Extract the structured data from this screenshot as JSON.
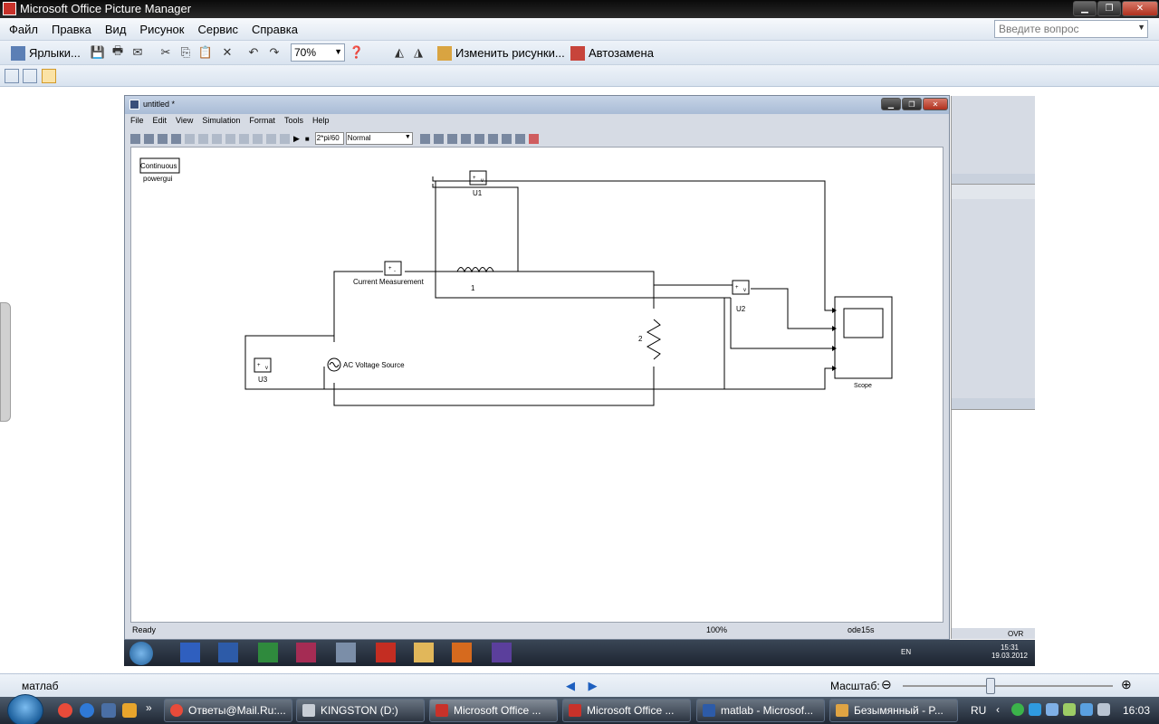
{
  "app": {
    "title": "Microsoft Office Picture Manager"
  },
  "menu": [
    "Файл",
    "Правка",
    "Вид",
    "Рисунок",
    "Сервис",
    "Справка"
  ],
  "help_search": {
    "placeholder": "Введите вопрос"
  },
  "toolbar": {
    "shortcuts_label": "Ярлыки...",
    "zoom_value": "70%",
    "edit_pictures_label": "Изменить рисунки...",
    "autocorrect_label": "Автозамена"
  },
  "simulink": {
    "title": "untitled *",
    "menu": [
      "File",
      "Edit",
      "View",
      "Simulation",
      "Format",
      "Tools",
      "Help"
    ],
    "stop_time": "2*pi/60",
    "mode": "Normal",
    "status_ready": "Ready",
    "status_zoom": "100%",
    "status_solver": "ode15s",
    "blocks": {
      "powergui_top": "Continuous",
      "powergui_bottom": "powergui",
      "u1": "U1",
      "u2": "U2",
      "u3": "U3",
      "current": "Current Measurement",
      "inductor": "1",
      "resistor": "2",
      "source": "AC Voltage Source",
      "scope": "Scope",
      "vm_plus": "+",
      "vm_v": "v",
      "vm_minus": "-"
    },
    "right_panel": {
      "ovr": "OVR"
    },
    "inner_taskbar": {
      "lang": "EN",
      "time": "15:31",
      "date": "19.03.2012"
    }
  },
  "bottom": {
    "filename": "матлаб",
    "zoom_label": "Масштаб:",
    "zoom_level": 0.42
  },
  "taskbar": {
    "tasks": [
      "Ответы@Mail.Ru:...",
      "KINGSTON (D:)",
      "Microsoft Office ...",
      "Microsoft Office ...",
      "matlab - Microsof...",
      "Безымянный - P..."
    ],
    "lang": "RU",
    "clock": "16:03"
  },
  "colors": {
    "title_bar": "#111111",
    "menu_bg": "#e4ebf4",
    "taskbar": "#2a3441"
  }
}
